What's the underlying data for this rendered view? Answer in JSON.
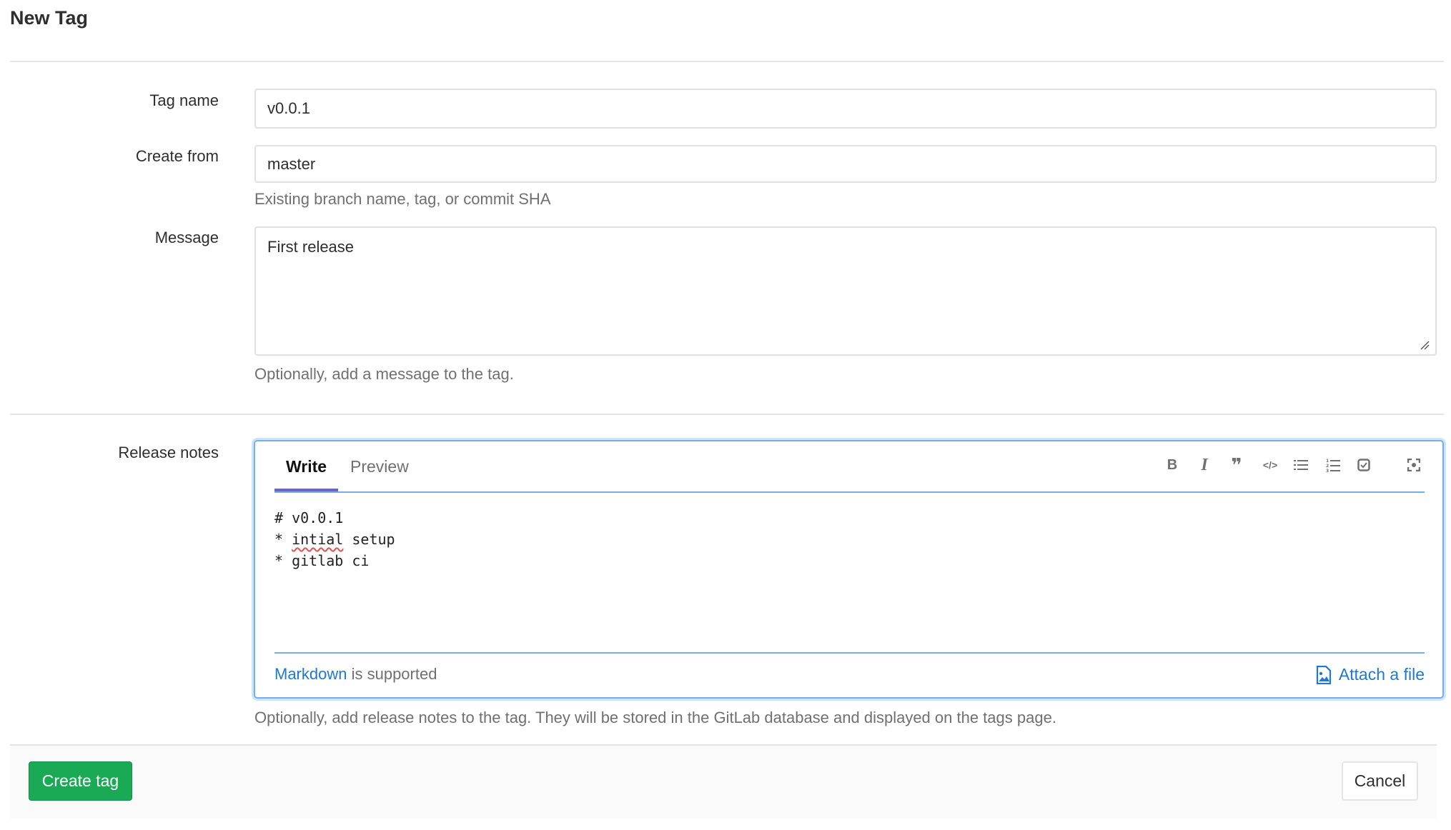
{
  "page": {
    "title": "New Tag"
  },
  "form": {
    "tag_name": {
      "label": "Tag name",
      "value": "v0.0.1"
    },
    "create_from": {
      "label": "Create from",
      "value": "master",
      "help": "Existing branch name, tag, or commit SHA"
    },
    "message": {
      "label": "Message",
      "value": "First release",
      "help": "Optionally, add a message to the tag."
    },
    "release_notes": {
      "label": "Release notes",
      "tabs": [
        {
          "label": "Write",
          "active": true
        },
        {
          "label": "Preview",
          "active": false
        }
      ],
      "toolbar": [
        {
          "icon": "bold-icon",
          "glyph": "B"
        },
        {
          "icon": "italic-icon",
          "glyph": "I"
        },
        {
          "icon": "quote-icon",
          "glyph": "❞"
        },
        {
          "icon": "code-icon",
          "glyph": "</>"
        },
        {
          "icon": "bullet-list-icon",
          "glyph": "☰"
        },
        {
          "icon": "numbered-list-icon",
          "glyph": "☷"
        },
        {
          "icon": "task-list-icon",
          "glyph": "☑"
        },
        {
          "icon": "fullscreen-icon",
          "glyph": "⛶"
        }
      ],
      "lines": [
        "# v0.0.1",
        "* ",
        "intial",
        " setup",
        "* gitlab ci"
      ],
      "markdown_link": "Markdown",
      "markdown_suffix": " is supported",
      "attach_label": "Attach a file",
      "help": "Optionally, add release notes to the tag. They will be stored in the GitLab database and displayed on the tags page."
    }
  },
  "actions": {
    "create": "Create tag",
    "cancel": "Cancel"
  },
  "colors": {
    "primary_green": "#1aaa55",
    "link_blue": "#1f78d1",
    "focus_blue": "#73afea",
    "tab_active": "#6b64c2"
  }
}
